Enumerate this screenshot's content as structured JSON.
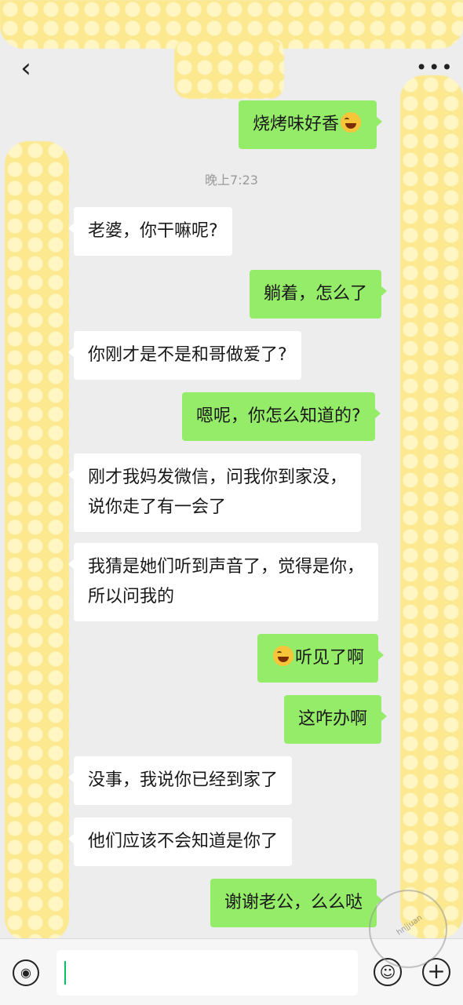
{
  "header": {
    "back_icon": "chevron-left-icon",
    "more_icon": "more-dots-icon"
  },
  "timestamp": "晚上7:23",
  "messages": [
    {
      "side": "out",
      "text": "烧烤味好香",
      "emoji_after": true
    },
    {
      "side": "in",
      "text": "老婆，你干嘛呢?"
    },
    {
      "side": "out",
      "text": "躺着，怎么了"
    },
    {
      "side": "in",
      "text": "你刚才是不是和哥做爱了?"
    },
    {
      "side": "out",
      "text": "嗯呢，你怎么知道的?"
    },
    {
      "side": "in",
      "line1": "刚才我妈发微信，问我你到家没，",
      "line2": "说你走了有一会了"
    },
    {
      "side": "in",
      "line1": "我猜是她们听到声音了，觉得是你，",
      "line2": "所以问我的"
    },
    {
      "side": "out",
      "text": "听见了啊",
      "emoji_before": true
    },
    {
      "side": "out",
      "text": "这咋办啊"
    },
    {
      "side": "in",
      "text": "没事，我说你已经到家了"
    },
    {
      "side": "in",
      "text": "他们应该不会知道是你了"
    },
    {
      "side": "out",
      "text": "谢谢老公，么么哒"
    }
  ],
  "input": {
    "voice_icon": "voice-icon",
    "emoji_icon": "emoji-icon",
    "plus_icon": "plus-icon"
  },
  "colors": {
    "sent_bubble": "#95ec69",
    "received_bubble": "#ffffff",
    "background": "#ededed",
    "mosaic": "#fbe88f"
  },
  "watermark": "hnjjuan"
}
